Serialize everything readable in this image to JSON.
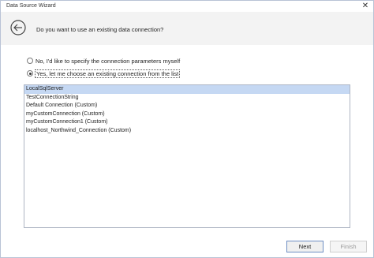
{
  "window": {
    "title": "Data Source Wizard",
    "close_glyph": "✕"
  },
  "header": {
    "back_icon": "arrow-left-circle-icon",
    "question": "Do you want to use an existing data connection?"
  },
  "options": {
    "specify_label": "No, I'd like to specify the connection parameters myself",
    "existing_label": "Yes, let me choose an existing connection from the list",
    "selected": "existing"
  },
  "connections": [
    "LocalSqlServer",
    "TestConnectionString",
    "Default Connection (Custom)",
    "myCustomConnection (Custom)",
    "myCustomConnection1 (Custom)",
    "localhost_Northwind_Connection (Custom)"
  ],
  "selected_connection_index": 0,
  "footer": {
    "next_label": "Next",
    "finish_label": "Finish"
  },
  "colors": {
    "selection": "#c5d8f3",
    "header_bg": "#f3f3f3",
    "border": "#aeb6c4"
  }
}
